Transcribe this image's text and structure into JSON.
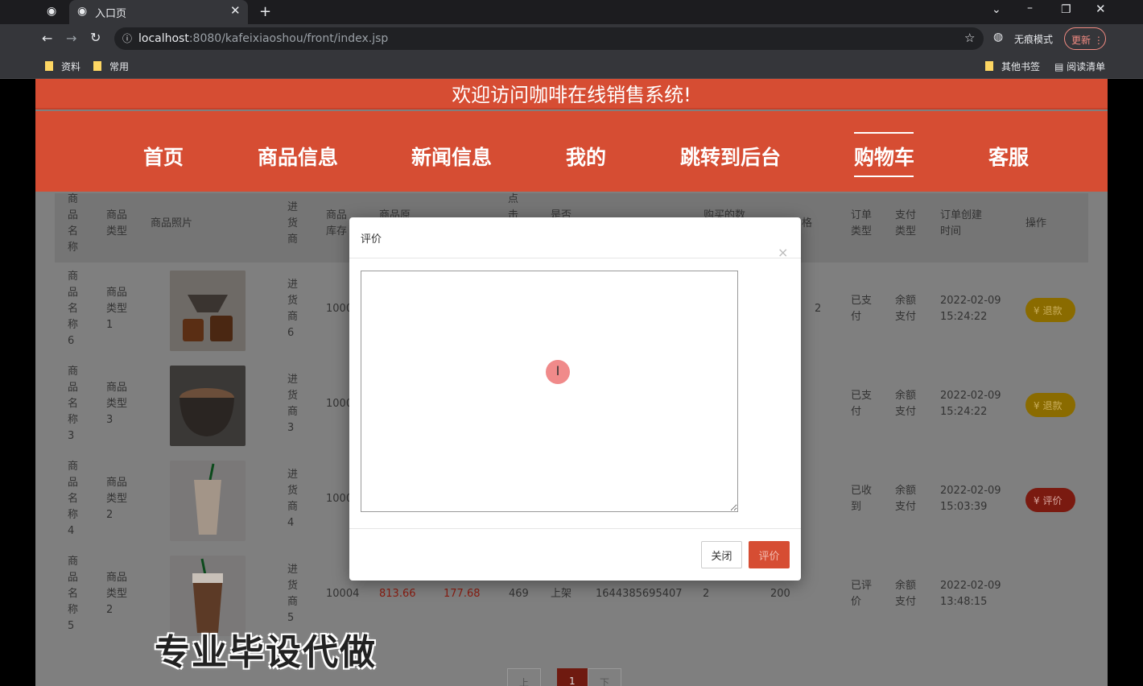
{
  "browser": {
    "tab_title": "入口页",
    "url_host": "localhost",
    "url_rest": ":8080/kafeixiaoshou/front/index.jsp",
    "incognito_label": "无痕模式",
    "update_label": "更新",
    "bookmarks": [
      "资料",
      "常用"
    ],
    "bookmarks_right": [
      "其他书签",
      "阅读清单"
    ]
  },
  "site": {
    "welcome": "欢迎访问咖啡在线销售系统!",
    "nav": [
      "首页",
      "商品信息",
      "新闻信息",
      "我的",
      "跳转到后台",
      "购物车",
      "客服"
    ],
    "active_nav": "购物车"
  },
  "table": {
    "headers": [
      "商品名称",
      "商品类型",
      "商品照片",
      "进货商",
      "商品库存",
      "商品原",
      "点击",
      "是否",
      "购买的数",
      "格",
      "订单类型",
      "支付类型",
      "订单创建时间",
      "操作"
    ],
    "rows": [
      {
        "name": "商品名称6",
        "type": "商品类型1",
        "supplier": "进货商6",
        "stock": "1000",
        "status": "已支付",
        "pay": "余额支付",
        "date": "2022-02-09",
        "time": "15:24:22",
        "action": "退款",
        "stray": "2"
      },
      {
        "name": "商品名称3",
        "type": "商品类型3",
        "supplier": "进货商3",
        "stock": "1000",
        "status": "已支付",
        "pay": "余额支付",
        "date": "2022-02-09",
        "time": "15:24:22",
        "action": "退款"
      },
      {
        "name": "商品名称4",
        "type": "商品类型2",
        "supplier": "进货商4",
        "stock": "1000",
        "status": "已收到",
        "pay": "余额支付",
        "date": "2022-02-09",
        "time": "15:03:39",
        "action": "评价"
      },
      {
        "name": "商品名称5",
        "type": "商品类型2",
        "supplier": "进货商5",
        "stock": "10004",
        "price1": "813.66",
        "price2": "177.68",
        "clicks": "469",
        "onsale": "上架",
        "code": "1644385695407",
        "qty": "2",
        "total": "200",
        "status": "已评价",
        "pay": "余额支付",
        "date": "2022-02-09",
        "time": "13:48:15"
      }
    ]
  },
  "pager": {
    "prev": "上一页",
    "current": "1",
    "next": "下一页"
  },
  "watermark": "专业毕设代做",
  "modal": {
    "title": "评价",
    "close_x": "×",
    "textarea_value": "",
    "cancel": "关闭",
    "submit": "评价"
  },
  "colors": {
    "accent": "#d64d33",
    "yellow_btn": "#f0b90b",
    "red_btn": "#c0392b"
  }
}
